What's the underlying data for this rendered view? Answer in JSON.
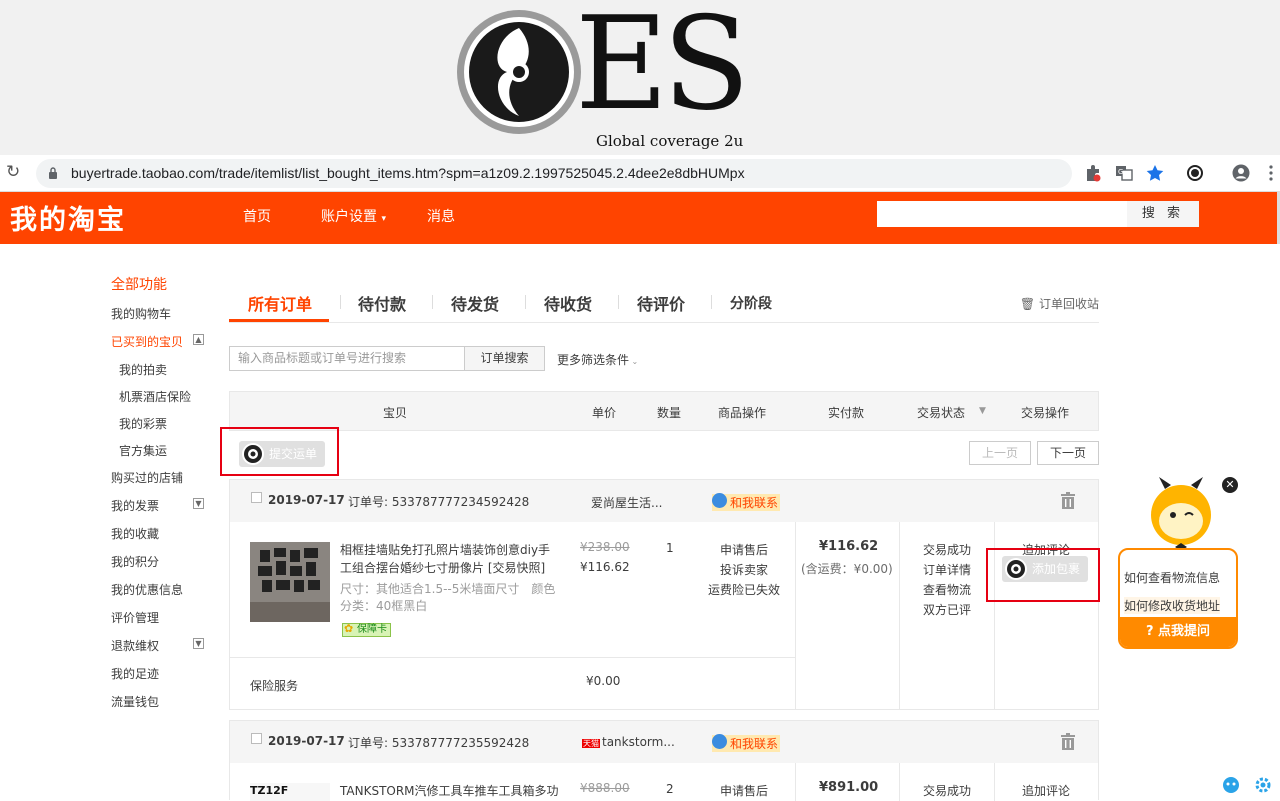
{
  "banner": {
    "logo_text": "ES",
    "tagline": "Global coverage 2u"
  },
  "browser": {
    "url": "buyertrade.taobao.com/trade/itemlist/list_bought_items.htm?spm=a1z09.2.1997525045.2.4dee2e8dbHUMpx"
  },
  "header": {
    "brand": "我的淘宝",
    "nav": [
      "首页",
      "账户设置",
      "消息"
    ],
    "search_button": "搜 索"
  },
  "sidebar": {
    "items": [
      {
        "label": "全部功能"
      },
      {
        "label": "我的购物车"
      },
      {
        "label": "已买到的宝贝"
      },
      {
        "label": "我的拍卖"
      },
      {
        "label": "机票酒店保险"
      },
      {
        "label": "我的彩票"
      },
      {
        "label": "官方集运"
      },
      {
        "label": "购买过的店铺"
      },
      {
        "label": "我的发票"
      },
      {
        "label": "我的收藏"
      },
      {
        "label": "我的积分"
      },
      {
        "label": "我的优惠信息"
      },
      {
        "label": "评价管理"
      },
      {
        "label": "退款维权"
      },
      {
        "label": "我的足迹"
      },
      {
        "label": "流量钱包"
      }
    ]
  },
  "tabs": {
    "items": [
      "所有订单",
      "待付款",
      "待发货",
      "待收货",
      "待评价",
      "分阶段"
    ],
    "recycle": "订单回收站"
  },
  "search": {
    "placeholder": "输入商品标题或订单号进行搜索",
    "button": "订单搜索",
    "more_filters": "更多筛选条件"
  },
  "table_head": [
    "宝贝",
    "单价",
    "数量",
    "商品操作",
    "实付款",
    "交易状态",
    "交易操作"
  ],
  "submit_waybill": "提交运单",
  "pager": {
    "prev": "上一页",
    "next": "下一页"
  },
  "orders": [
    {
      "date": "2019-07-17",
      "order_no": "订单号: 533787777234592428",
      "shop": "爱尚屋生活...",
      "contact": "和我联系",
      "title": "相框挂墙贴免打孔照片墙装饰创意diy手工组合摆台婚纱七寸册像片 [交易快照]",
      "sku": "尺寸：其他适合1.5--5米墙面尺寸　颜色分类：40框黑白",
      "badge": "保障卡",
      "orig_price": "¥238.00",
      "price": "¥116.62",
      "qty": "1",
      "ops": [
        "申请售后",
        "投诉卖家",
        "运费险已失效"
      ],
      "paid": "¥116.62",
      "shipping": "(含运费：¥0.00)",
      "status": [
        "交易成功",
        "订单详情",
        "查看物流",
        "双方已评"
      ],
      "action": "追加评论",
      "add_parcel": "添加包裹",
      "insurance_label": "保险服务",
      "insurance_price": "¥0.00"
    },
    {
      "date": "2019-07-17",
      "order_no": "订单号: 533787777235592428",
      "shop": "tankstorm...",
      "tmall": "天猫",
      "contact": "和我联系",
      "thumb_text": "TZ12F",
      "title": "TANKSTORM汽修工具车推车工具箱多功",
      "orig_price": "¥888.00",
      "qty": "2",
      "op": "申请售后",
      "paid": "¥891.00",
      "status": "交易成功",
      "action": "追加评论"
    }
  ],
  "help": {
    "q1": "如何查看物流信息",
    "q2": "如何修改收货地址",
    "ask": "点我提问",
    "close": "✕"
  }
}
